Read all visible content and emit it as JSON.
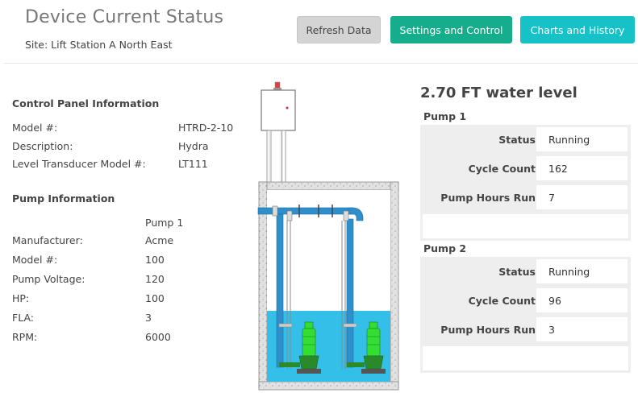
{
  "header": {
    "title": "Device Current Status",
    "site": "Site: Lift Station A North East",
    "buttons": {
      "refresh": "Refresh Data",
      "settings": "Settings and Control",
      "charts": "Charts and History"
    }
  },
  "control_panel": {
    "title": "Control Panel Information",
    "rows": [
      {
        "label": "Model #:",
        "value": "HTRD-2-10"
      },
      {
        "label": "Description:",
        "value": "Hydra"
      },
      {
        "label": "Level Transducer Model #:",
        "value": "LT111"
      }
    ]
  },
  "pump_info": {
    "title": "Pump Information",
    "column": "Pump 1",
    "rows": [
      {
        "label": "Manufacturer:",
        "value": "Acme"
      },
      {
        "label": "Model #:",
        "value": "100"
      },
      {
        "label": "Pump Voltage:",
        "value": "120"
      },
      {
        "label": "HP:",
        "value": "100"
      },
      {
        "label": "FLA:",
        "value": "3"
      },
      {
        "label": "RPM:",
        "value": "6000"
      }
    ]
  },
  "level": {
    "text": "2.70 FT water level"
  },
  "pumps": [
    {
      "title": "Pump 1",
      "rows": [
        {
          "label": "Status",
          "value": "Running"
        },
        {
          "label": "Cycle Count",
          "value": "162"
        },
        {
          "label": "Pump Hours Run",
          "value": "7"
        }
      ]
    },
    {
      "title": "Pump 2",
      "rows": [
        {
          "label": "Status",
          "value": "Running"
        },
        {
          "label": "Cycle Count",
          "value": "96"
        },
        {
          "label": "Pump Hours Run",
          "value": "3"
        }
      ]
    }
  ],
  "colors": {
    "settings_button": "#16ad8c",
    "charts_button": "#17c1c8",
    "refresh_button": "#d4d4d4",
    "water": "#33bfe8",
    "pipe": "#2f8fcb",
    "pump_body": "#33dd33"
  }
}
